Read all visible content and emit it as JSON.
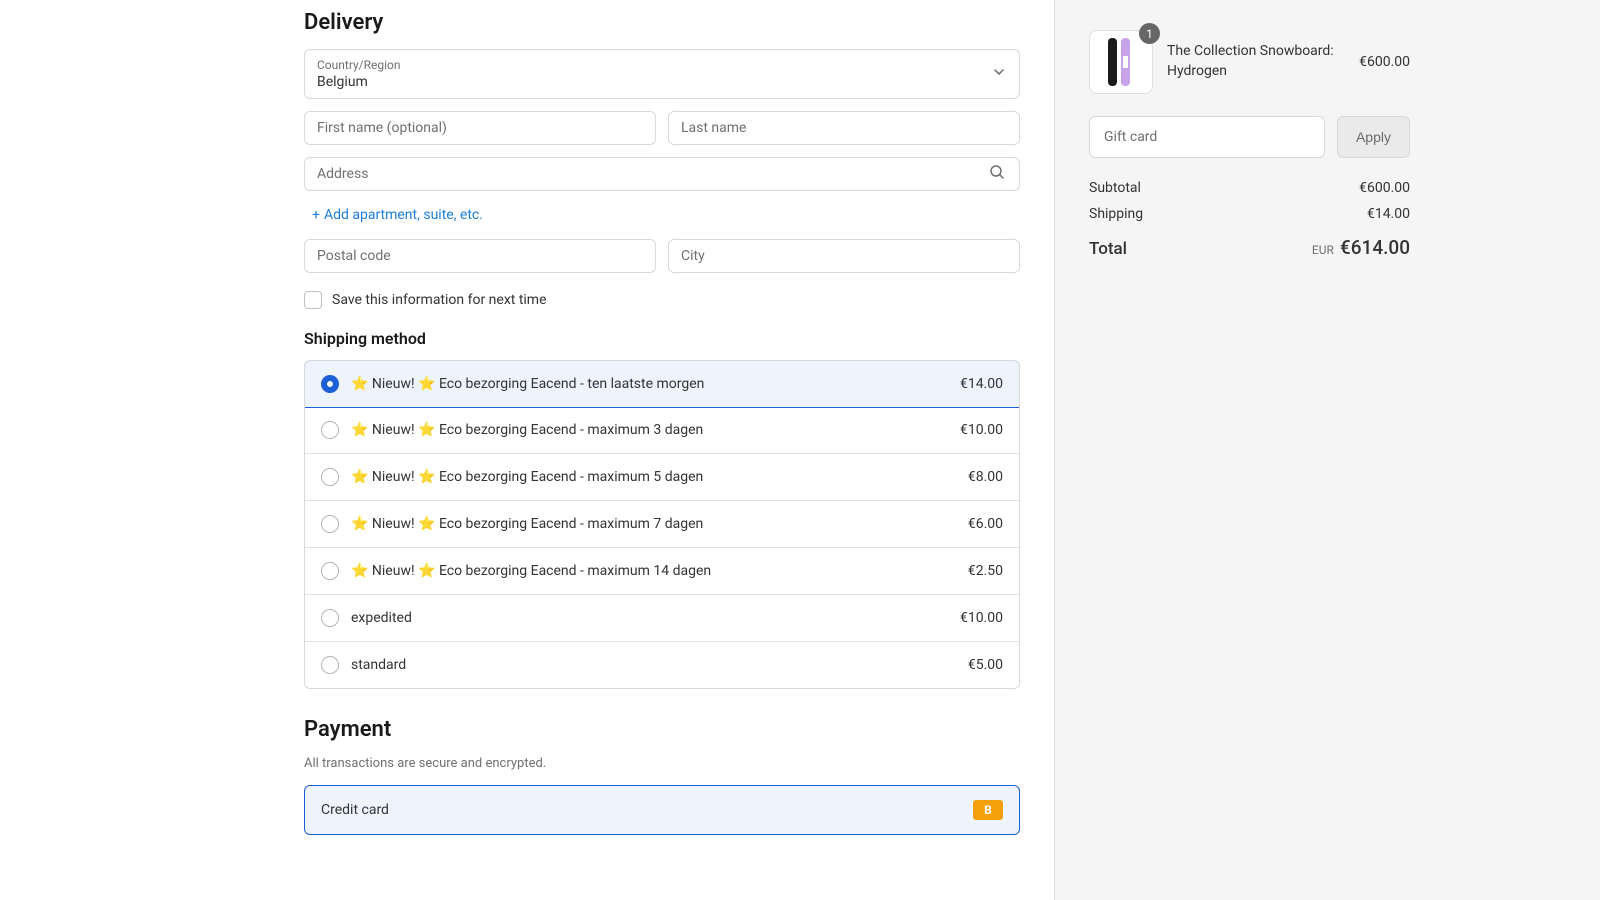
{
  "delivery": {
    "title": "Delivery",
    "country_label": "Country/Region",
    "country_value": "Belgium",
    "first_name_label": "First name (optional)",
    "last_name_label": "Last name",
    "address_label": "Address",
    "add_apartment": "Add apartment, suite, etc.",
    "postal_label": "Postal code",
    "city_label": "City",
    "save_info": "Save this information for next time"
  },
  "shipping": {
    "title": "Shipping method",
    "options": [
      {
        "label": "⭐ Nieuw! ⭐ Eco bezorging Eacend - ten laatste morgen",
        "price": "€14.00",
        "selected": true
      },
      {
        "label": "⭐ Nieuw! ⭐ Eco bezorging Eacend - maximum 3 dagen",
        "price": "€10.00",
        "selected": false
      },
      {
        "label": "⭐ Nieuw! ⭐ Eco bezorging Eacend - maximum 5 dagen",
        "price": "€8.00",
        "selected": false
      },
      {
        "label": "⭐ Nieuw! ⭐ Eco bezorging Eacend - maximum 7 dagen",
        "price": "€6.00",
        "selected": false
      },
      {
        "label": "⭐ Nieuw! ⭐ Eco bezorging Eacend - maximum 14 dagen",
        "price": "€2.50",
        "selected": false
      },
      {
        "label": "expedited",
        "price": "€10.00",
        "selected": false
      },
      {
        "label": "standard",
        "price": "€5.00",
        "selected": false
      }
    ]
  },
  "payment": {
    "title": "Payment",
    "note": "All transactions are secure and encrypted.",
    "credit_card": "Credit card",
    "badge": "B"
  },
  "cart": {
    "item_name": "The Collection Snowboard: Hydrogen",
    "item_price": "€600.00",
    "qty": "1",
    "gift_placeholder": "Gift card",
    "apply": "Apply",
    "subtotal_label": "Subtotal",
    "subtotal_value": "€600.00",
    "shipping_label": "Shipping",
    "shipping_value": "€14.00",
    "total_label": "Total",
    "total_currency": "EUR",
    "total_value": "€614.00"
  }
}
